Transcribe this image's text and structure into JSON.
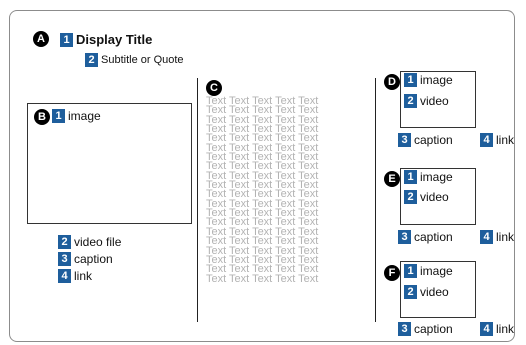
{
  "section_a": {
    "badge": "A",
    "title": {
      "num": "1",
      "label": "Display Title"
    },
    "subtitle": {
      "num": "2",
      "label": "Subtitle or Quote"
    }
  },
  "section_b": {
    "badge": "B",
    "image": {
      "num": "1",
      "label": "image"
    },
    "video": {
      "num": "2",
      "label": "video file"
    },
    "caption": {
      "num": "3",
      "label": "caption"
    },
    "link": {
      "num": "4",
      "label": "link"
    }
  },
  "section_c": {
    "badge": "C",
    "text_line": "Text Text Text Text Text",
    "line_count": 20
  },
  "section_d": {
    "badge": "D",
    "image": {
      "num": "1",
      "label": "image"
    },
    "video": {
      "num": "2",
      "label": "video"
    },
    "caption": {
      "num": "3",
      "label": "caption"
    },
    "link": {
      "num": "4",
      "label": "link"
    }
  },
  "section_e": {
    "badge": "E",
    "image": {
      "num": "1",
      "label": "image"
    },
    "video": {
      "num": "2",
      "label": "video"
    },
    "caption": {
      "num": "3",
      "label": "caption"
    },
    "link": {
      "num": "4",
      "label": "link"
    }
  },
  "section_f": {
    "badge": "F",
    "image": {
      "num": "1",
      "label": "image"
    },
    "video": {
      "num": "2",
      "label": "video"
    },
    "caption": {
      "num": "3",
      "label": "caption"
    },
    "link": {
      "num": "4",
      "label": "link"
    }
  }
}
